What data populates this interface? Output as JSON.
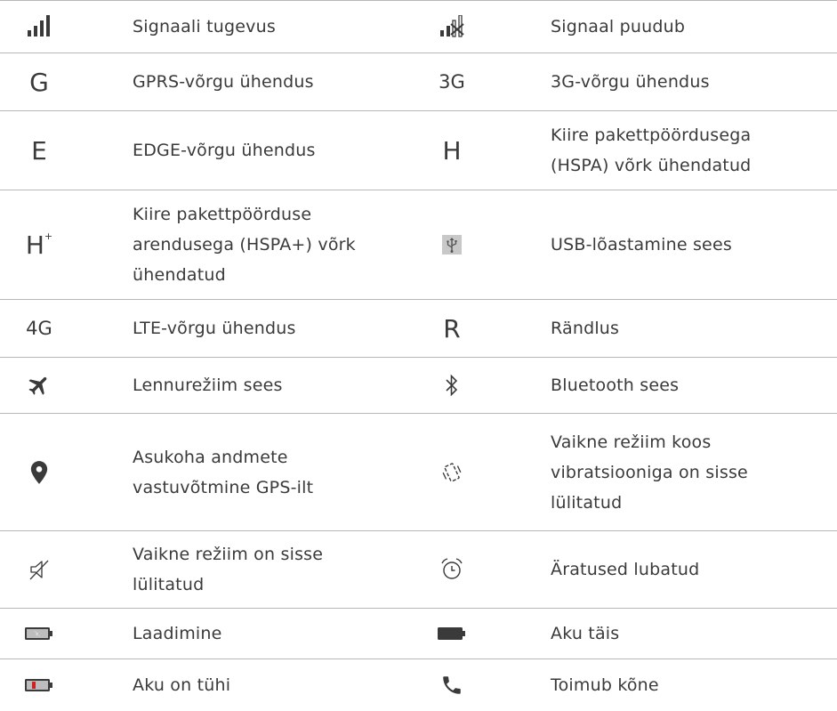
{
  "rows": [
    {
      "left": {
        "icon": "signal-strength-icon",
        "text": "Signaali tugevus"
      },
      "right": {
        "icon": "no-signal-icon",
        "text": "Signaal puudub"
      }
    },
    {
      "left": {
        "icon": "gprs-icon",
        "glyph": "G",
        "text": "GPRS-võrgu ühendus"
      },
      "right": {
        "icon": "3g-icon",
        "glyph": "3G",
        "text": "3G-võrgu ühendus"
      }
    },
    {
      "left": {
        "icon": "edge-icon",
        "glyph": "E",
        "text": "EDGE-võrgu ühendus"
      },
      "right": {
        "icon": "hspa-icon",
        "glyph": "H",
        "text": "Kiire pakettpöördusega (HSPA) võrk ühendatud"
      }
    },
    {
      "left": {
        "icon": "hspa-plus-icon",
        "glyph": "H",
        "glyph_sup": "+",
        "text": "Kiire pakettpöörduse arendusega (HSPA+) võrk ühendatud"
      },
      "right": {
        "icon": "usb-tethering-icon",
        "text": "USB-lõastamine sees"
      }
    },
    {
      "left": {
        "icon": "4g-icon",
        "glyph": "4G",
        "text": "LTE-võrgu ühendus"
      },
      "right": {
        "icon": "roaming-icon",
        "glyph": "R",
        "text": "Rändlus"
      }
    },
    {
      "left": {
        "icon": "airplane-icon",
        "text": "Lennurežiim sees"
      },
      "right": {
        "icon": "bluetooth-icon",
        "text": "Bluetooth sees"
      }
    },
    {
      "left": {
        "icon": "location-pin-icon",
        "text": "Asukoha andmete vastuvõtmine GPS-ilt"
      },
      "right": {
        "icon": "vibrate-icon",
        "text": "Vaikne režiim koos vibratsiooniga on sisse lülitatud"
      }
    },
    {
      "left": {
        "icon": "silent-mode-icon",
        "text": "Vaikne režiim on sisse lülitatud"
      },
      "right": {
        "icon": "alarm-clock-icon",
        "text": "Äratused lubatud"
      }
    },
    {
      "left": {
        "icon": "battery-charging-icon",
        "text": "Laadimine"
      },
      "right": {
        "icon": "battery-full-icon",
        "text": "Aku täis"
      }
    },
    {
      "left": {
        "icon": "battery-empty-icon",
        "text": "Aku on tühi"
      },
      "right": {
        "icon": "phone-call-icon",
        "text": "Toimub kõne"
      }
    }
  ],
  "colors": {
    "text": "#3a3a3a",
    "divider": "#b7b7b7",
    "battery_low": "#cc2222",
    "usb_bg": "#c8c8c8"
  }
}
